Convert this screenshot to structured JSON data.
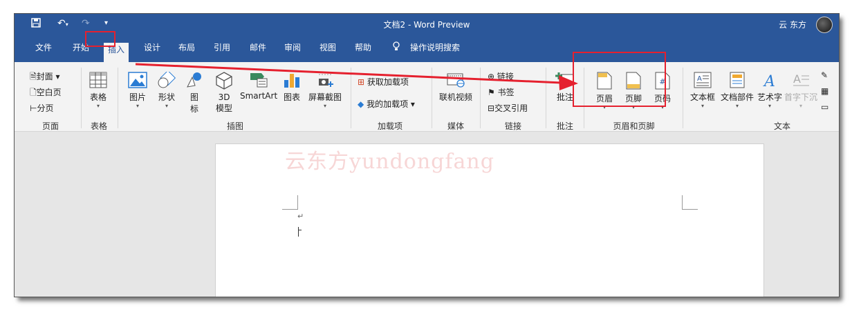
{
  "window": {
    "title": "文档2  -  Word Preview",
    "user": "云 东方"
  },
  "qat": {
    "save_icon": "save-icon",
    "undo_icon": "undo-icon",
    "redo_icon": "redo-icon",
    "customize_icon": "customize-qat-icon"
  },
  "tabs": [
    "文件",
    "开始",
    "插入",
    "设计",
    "布局",
    "引用",
    "邮件",
    "审阅",
    "视图",
    "帮助"
  ],
  "active_tab": "插入",
  "tell_me": "操作说明搜索",
  "ribbon": {
    "pages": {
      "cover": "封面",
      "blank": "空白页",
      "break": "分页",
      "group": "页面"
    },
    "tables": {
      "table": "表格",
      "group": "表格"
    },
    "illustrations": {
      "pictures": "图片",
      "shapes": "形状",
      "icons_l1": "图",
      "icons_l2": "标",
      "model_l1": "3D",
      "model_l2": "模型",
      "smartart": "SmartArt",
      "chart": "图表",
      "screenshot": "屏幕截图",
      "group": "插图"
    },
    "addins": {
      "get": "获取加载项",
      "my": "我的加载项",
      "group": "加载项"
    },
    "media": {
      "video": "联机视频",
      "group": "媒体"
    },
    "links": {
      "link": "链接",
      "bookmark": "书签",
      "crossref": "交叉引用",
      "group": "链接"
    },
    "comments": {
      "comment": "批注",
      "group": "批注"
    },
    "header_footer": {
      "header": "页眉",
      "footer": "页脚",
      "page_number": "页码",
      "group": "页眉和页脚"
    },
    "text": {
      "textbox": "文本框",
      "quickparts": "文档部件",
      "wordart": "艺术字",
      "dropcap": "首字下沉",
      "group": "文本"
    }
  },
  "document": {
    "watermark": "云东方yundongfang",
    "paragraph_mark": "↵"
  },
  "colors": {
    "accent": "#2b579a",
    "highlight": "#e5202e"
  }
}
